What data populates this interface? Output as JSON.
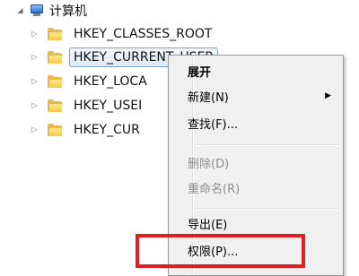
{
  "tree": {
    "root": {
      "label": "计算机",
      "expander": "◢",
      "icon": "computer-icon"
    },
    "keys": [
      {
        "label": "HKEY_CLASSES_ROOT",
        "expander": "▷",
        "icon": "folder-icon",
        "selected": false
      },
      {
        "label": "HKEY_CURRENT_USER",
        "expander": "▷",
        "icon": "folder-icon",
        "selected": true
      },
      {
        "label": "HKEY_LOCA",
        "expander": "▷",
        "icon": "folder-icon",
        "selected": false
      },
      {
        "label": "HKEY_USEI",
        "expander": "▷",
        "icon": "folder-icon",
        "selected": false
      },
      {
        "label": "HKEY_CUR",
        "expander": "▷",
        "icon": "folder-icon",
        "selected": false
      }
    ]
  },
  "context_menu": {
    "items": [
      {
        "label": "展开",
        "bold": true,
        "disabled": false
      },
      {
        "label": "新建(N)",
        "submenu_arrow": "▶",
        "disabled": false
      },
      {
        "label": "查找(F)...",
        "disabled": false
      },
      {
        "label": "删除(D)",
        "disabled": true
      },
      {
        "label": "重命名(R)",
        "disabled": true
      },
      {
        "label": "导出(E)",
        "disabled": false
      },
      {
        "label": "权限(P)...",
        "disabled": false,
        "highlighted": true
      }
    ]
  },
  "colors": {
    "highlight": "#e02020",
    "selection_border": "#7da2ce",
    "disabled_text": "#8d8d8d"
  }
}
